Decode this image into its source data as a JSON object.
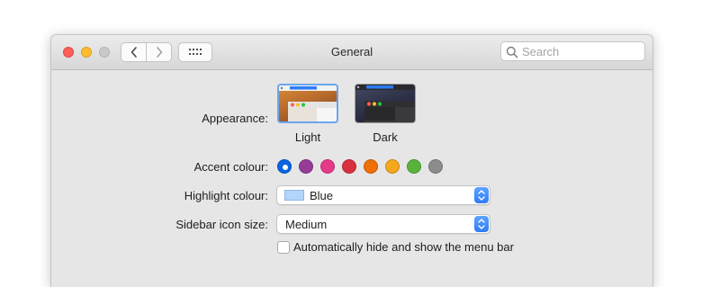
{
  "window": {
    "title": "General"
  },
  "toolbar": {
    "search_placeholder": "Search",
    "back_icon": "chevron-left-icon",
    "forward_icon": "chevron-right-icon",
    "grid_icon": "grid-icon"
  },
  "appearance": {
    "label": "Appearance:",
    "options": [
      {
        "name": "Light",
        "selected": true
      },
      {
        "name": "Dark",
        "selected": false
      }
    ]
  },
  "accent": {
    "label": "Accent colour:",
    "colors": [
      "#0a63e1",
      "#953d96",
      "#e5398a",
      "#d93040",
      "#ef6f08",
      "#f4a81c",
      "#58b33c",
      "#8c8c8c"
    ],
    "selected_index": 0
  },
  "highlight": {
    "label": "Highlight colour:",
    "value": "Blue",
    "chip_color": "#b3d4fb"
  },
  "sidebar": {
    "label": "Sidebar icon size:",
    "value": "Medium"
  },
  "menubar": {
    "label": "Automatically hide and show the menu bar",
    "checked": false
  }
}
